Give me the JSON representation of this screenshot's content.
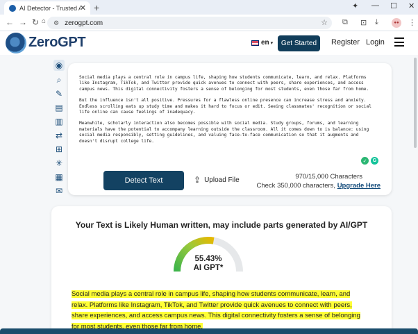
{
  "browser": {
    "tab_title": "AI Detector - Trusted AI Che",
    "url": "zerogpt.com"
  },
  "header": {
    "brand": "ZeroGPT",
    "language": "en",
    "get_started": "Get Started",
    "register": "Register",
    "login": "Login"
  },
  "sidebar": {
    "tools": [
      "home-icon",
      "search-doc-icon",
      "pen-icon",
      "document-icon",
      "book-icon",
      "translate-icon",
      "grammar-icon",
      "spark-icon",
      "table-icon",
      "mail-icon"
    ]
  },
  "input": {
    "paragraphs": [
      "Social media plays a central role in campus life, shaping how students communicate, learn, and relax. Platforms like Instagram, TikTok, and Twitter provide quick avenues to connect with peers, share experiences, and access campus news. This digital connectivity fosters a sense of belonging for most students, even those far from home.",
      "But the influence isn't all positive. Pressures for a flawless online presence can increase stress and anxiety. Endless scrolling eats up study time and makes it hard to focus or edit. Seeing classmates' recognition or social life online can cause feelings of inadequacy.",
      "Meanwhile, scholarly interaction also becomes possible with social media. Study groups, forums, and learning materials have the potential to accompany learning outside the classroom. All it comes down to is balance: using social media responsibly, setting guidelines, and valuing face-to-face communication so that it augments and doesn't disrupt college life."
    ],
    "detect_label": "Detect Text",
    "upload_label": "Upload File",
    "char_count": "970/15,000 Characters",
    "check_prefix": "Check 350,000 characters, ",
    "upgrade_label": "Upgrade Here"
  },
  "result": {
    "title": "Your Text is Likely Human written, may include parts generated by AI/GPT",
    "percentage": "55.43%",
    "percentage_value": 55.43,
    "percentage_label": "AI GPT*",
    "highlighted_text": "Social media plays a central role in campus life, shaping how students communicate, learn, and relax. Platforms like Instagram, TikTok, and Twitter provide quick avenues to connect with peers, share experiences, and access campus news. This digital connectivity fosters a sense of belonging for most students, even those far from home."
  },
  "colors": {
    "brand_dark": "#134262",
    "highlight": "#ffff36",
    "gauge_green": "#3cb44b",
    "gauge_yellow": "#e6b800"
  }
}
